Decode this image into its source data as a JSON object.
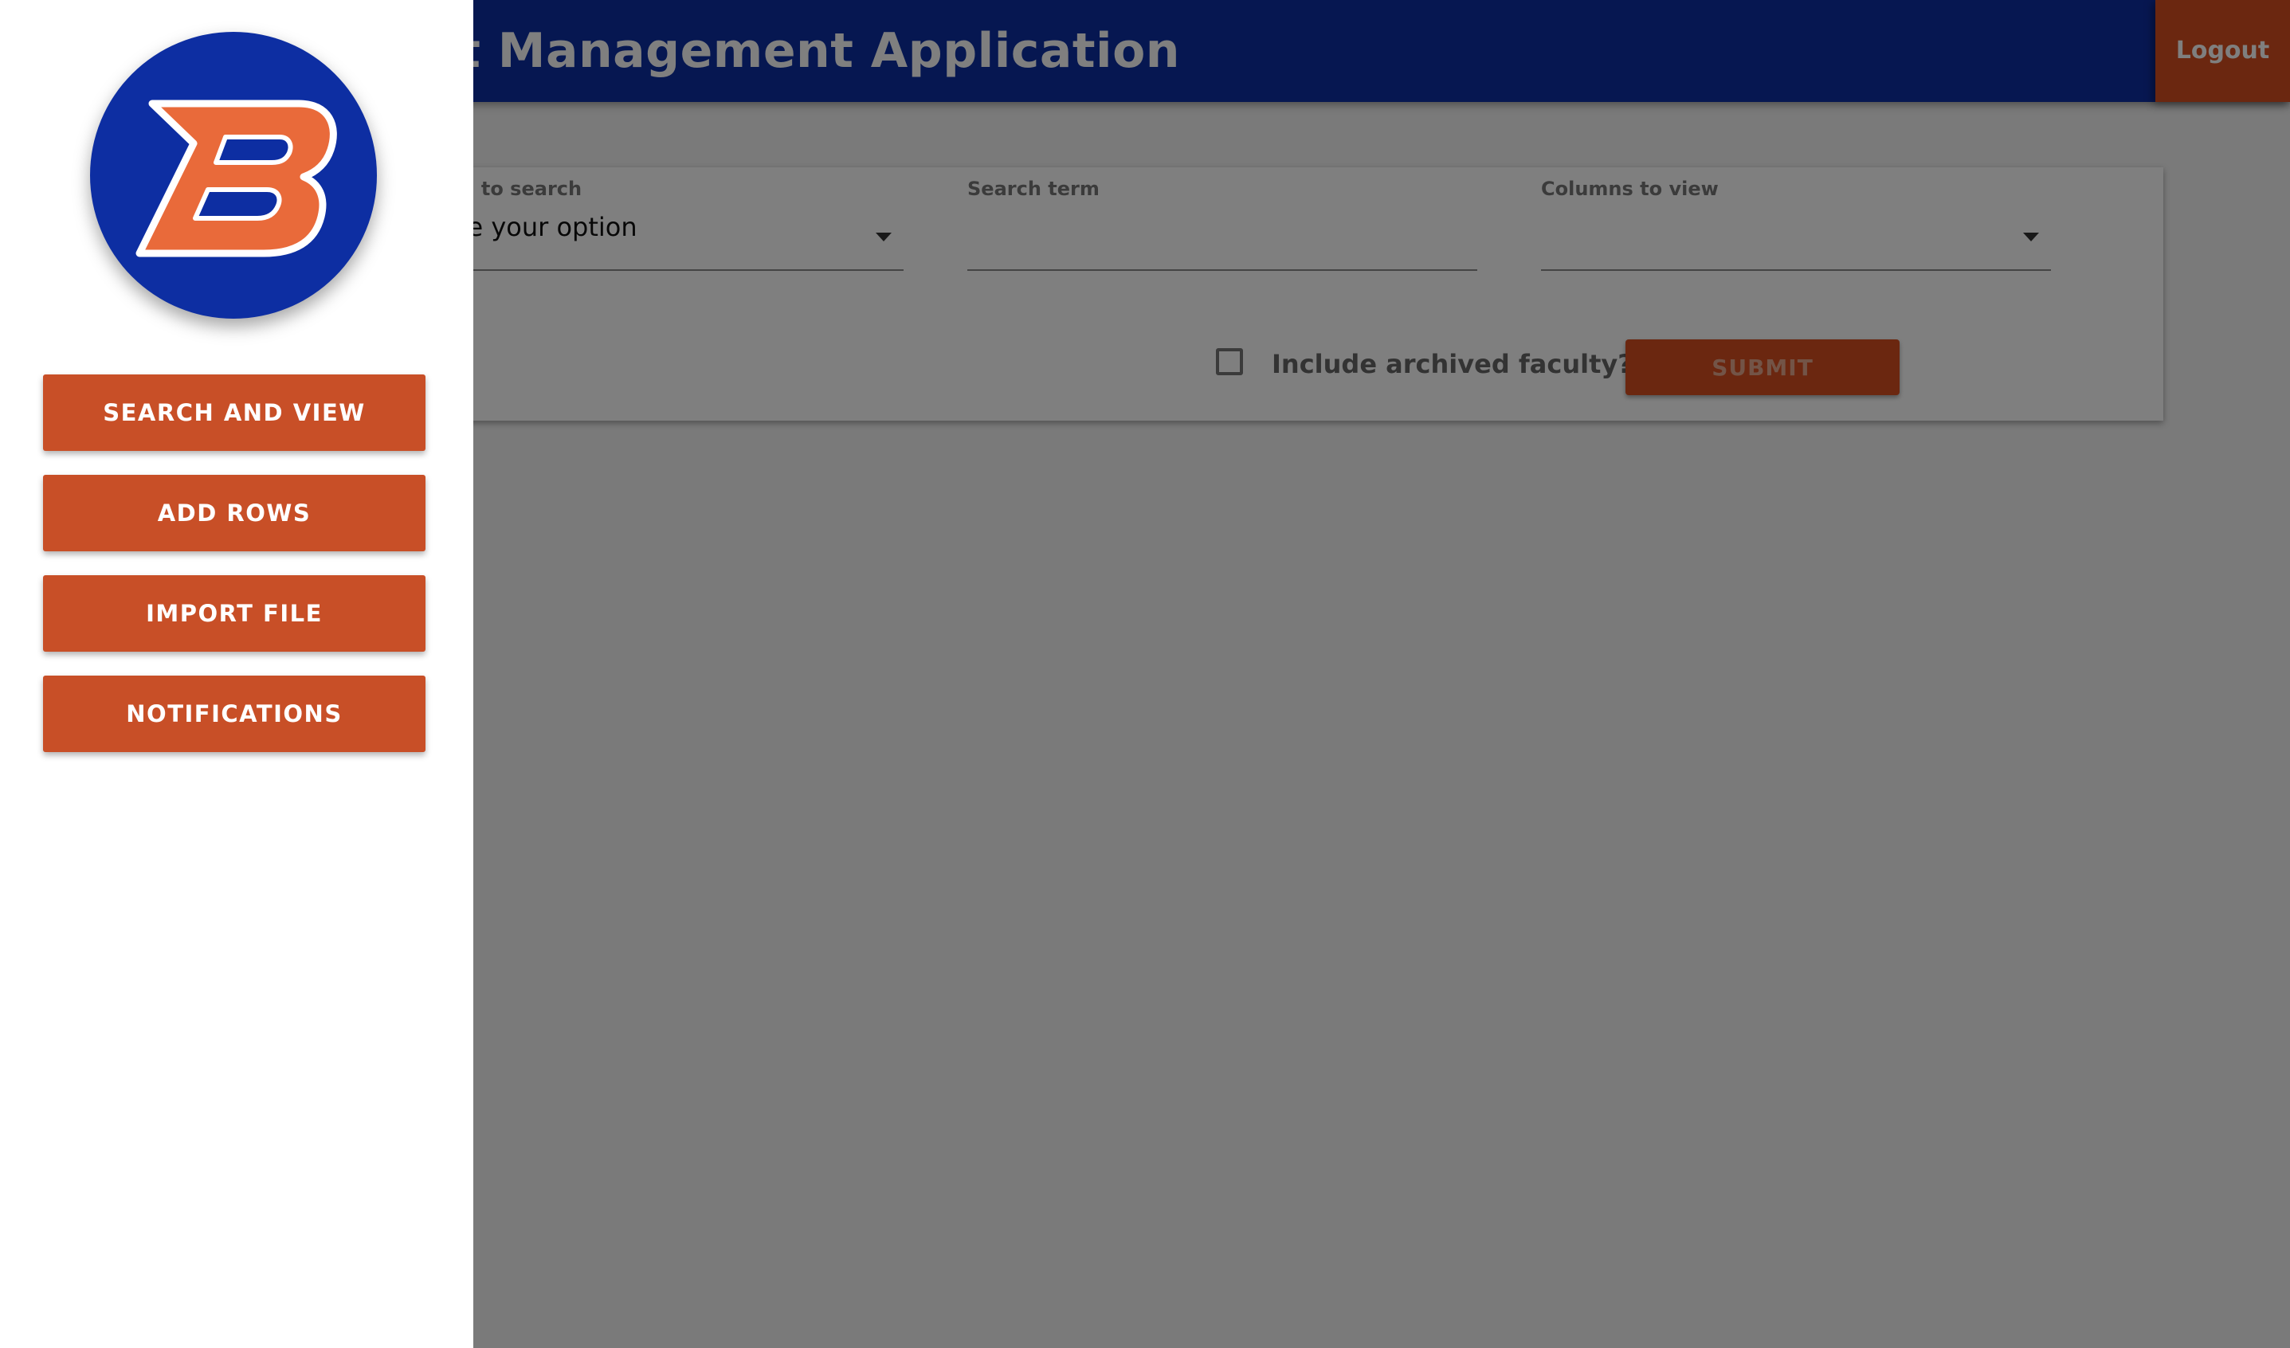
{
  "header": {
    "title": "Faculty Contact Management Application",
    "logout_label": "Logout"
  },
  "search": {
    "column_label": "Column to search",
    "column_value": "Choose your option",
    "term_label": "Search term",
    "term_value": "",
    "columns_view_label": "Columns to view",
    "columns_view_value": "",
    "archived_label": "Include archived faculty?",
    "archived_checked": false,
    "submit_label": "SUBMIT"
  },
  "drawer": {
    "logo_letter": "B",
    "items": [
      {
        "label": "SEARCH AND VIEW"
      },
      {
        "label": "ADD ROWS"
      },
      {
        "label": "IMPORT FILE"
      },
      {
        "label": "NOTIFICATIONS"
      }
    ]
  },
  "colors": {
    "header_blue": "#0d2ea2",
    "accent_orange": "#d64f21",
    "nav_orange": "#c84f27",
    "logo_orange": "#e96a3a",
    "scrim": "rgba(0,0,0,0.5)"
  },
  "icons": {
    "dropdown": "caret-down-icon",
    "logo": "b-logo-icon"
  }
}
